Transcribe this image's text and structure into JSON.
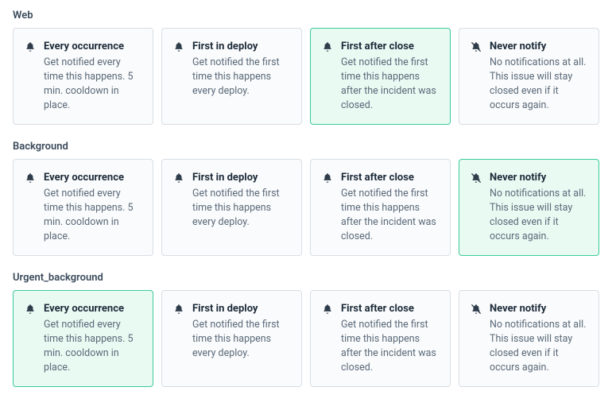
{
  "options": {
    "every": {
      "title": "Every occurrence",
      "desc": "Get notified every time this happens. 5 min. cooldown in place.",
      "icon": "bell-icon"
    },
    "deploy": {
      "title": "First in deploy",
      "desc": "Get notified the first time this happens every deploy.",
      "icon": "bell-icon"
    },
    "close": {
      "title": "First after close",
      "desc": "Get notified the first time this happens after the incident was closed.",
      "icon": "bell-icon"
    },
    "never": {
      "title": "Never notify",
      "desc": "No notifications at all. This issue will stay closed even if it occurs again.",
      "icon": "bell-slash-icon"
    }
  },
  "sections": [
    {
      "title": "Web",
      "selected": "close"
    },
    {
      "title": "Background",
      "selected": "never"
    },
    {
      "title": "Urgent_background",
      "selected": "every"
    }
  ]
}
